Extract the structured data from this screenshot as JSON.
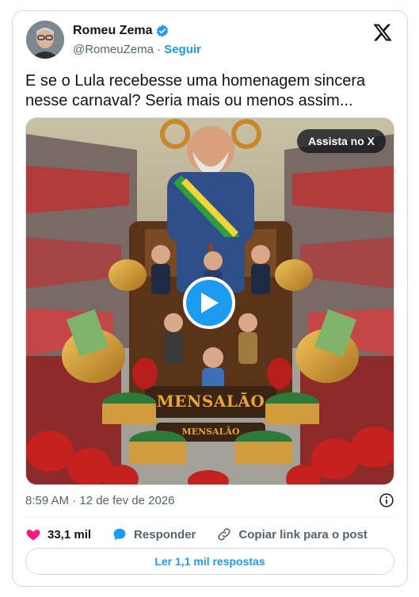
{
  "author": {
    "name": "Romeu Zema",
    "handle": "@RomeuZema",
    "separator": "·",
    "follow_label": "Seguir"
  },
  "tweet": {
    "text": "E se o Lula recebesse uma homenagem sincera nesse carnaval? Seria mais ou menos assim..."
  },
  "media": {
    "watch_label": "Assista no X",
    "float_banner": "MENSALÃO",
    "float_sub_banner": "MENSALÃO",
    "icons": [
      "play-icon"
    ]
  },
  "meta": {
    "timestamp": "8:59 AM · 12 de fev de 2026"
  },
  "actions": {
    "likes": "33,1 mil",
    "reply_label": "Responder",
    "copy_link_label": "Copiar link para o post",
    "read_replies_label": "Ler 1,1 mil respostas"
  },
  "colors": {
    "accent": "#1d9bf0",
    "like": "#f91880",
    "muted": "#536471",
    "text": "#0f1419"
  }
}
